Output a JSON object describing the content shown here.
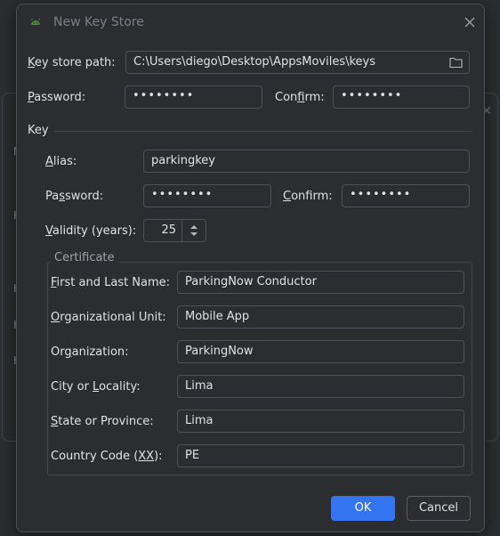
{
  "background_dialog": {
    "letters": [
      "M",
      "K",
      "K",
      "K",
      "K"
    ]
  },
  "dialog": {
    "title": "New Key Store",
    "keystore": {
      "path_label_pre": "K",
      "path_label_rest": "ey store path:",
      "path_value": "C:\\Users\\diego\\Desktop\\AppsMoviles\\keys",
      "password_label_pre": "P",
      "password_label_rest": "assword:",
      "password_value": "••••••••",
      "confirm_label_pre": "Con",
      "confirm_label_u": "f",
      "confirm_label_rest": "irm:",
      "confirm_value": "••••••••"
    },
    "key": {
      "section_label": "Key",
      "alias_label_pre": "A",
      "alias_label_rest": "lias:",
      "alias_value": "parkingkey",
      "password_label_pre": "Pa",
      "password_label_u": "s",
      "password_label_rest": "sword:",
      "password_value": "••••••••",
      "confirm_label_pre": "C",
      "confirm_label_rest": "onfirm:",
      "confirm_value": "••••••••",
      "validity_label_pre": "V",
      "validity_label_rest": "alidity (years):",
      "validity_value": "25"
    },
    "certificate": {
      "legend": "Certificate",
      "fields": [
        {
          "pre": "F",
          "rest": "irst and Last Name:",
          "value": "ParkingNow Conductor"
        },
        {
          "pre": "O",
          "rest": "rganizational Unit:",
          "value": "Mobile App"
        },
        {
          "pre": "Or",
          "u": "g",
          "rest": "anization:",
          "value": "ParkingNow"
        },
        {
          "pre": "City or ",
          "u": "L",
          "rest": "ocality:",
          "value": "Lima"
        },
        {
          "pre": "S",
          "rest": "tate or Province:",
          "value": "Lima"
        },
        {
          "pre": "Country Code (",
          "u": "XX",
          "rest": "):",
          "value": "PE"
        }
      ]
    },
    "buttons": {
      "ok": "OK",
      "cancel": "Cancel"
    }
  },
  "colors": {
    "accent": "#3574f0",
    "background": "#2b2d30",
    "border": "#4e5157"
  }
}
